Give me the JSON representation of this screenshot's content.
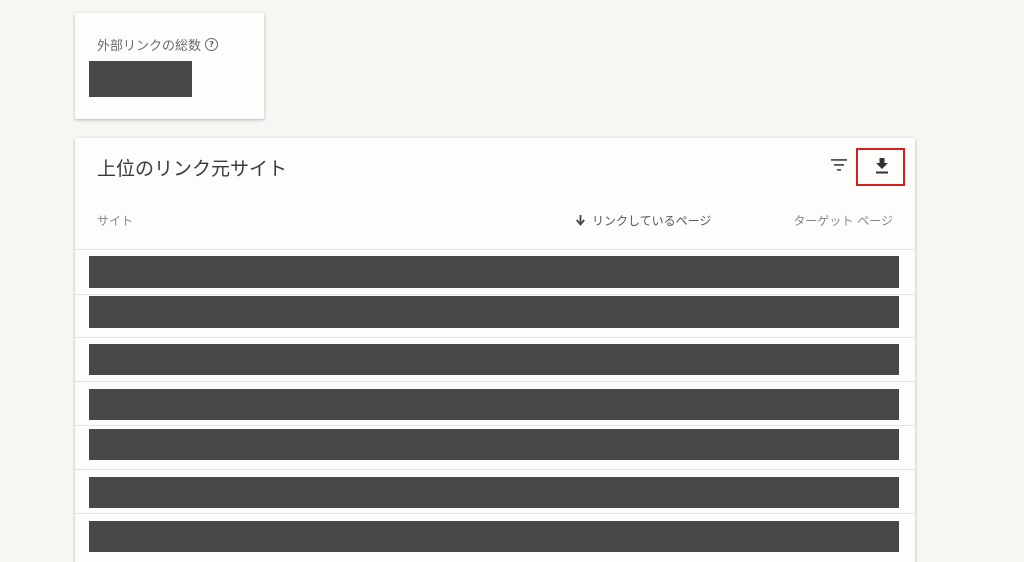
{
  "summary": {
    "total_label": "外部リンクの総数",
    "total_value": ""
  },
  "top_sites": {
    "title": "上位のリンク元サイト",
    "columns": {
      "site": "サイト",
      "linking_pages": "リンクしているページ",
      "target_pages": "ターゲット ページ"
    },
    "sort_column": "linking_pages",
    "sort_direction": "descending",
    "rows_visible": 7
  },
  "icons": {
    "help": "help-circle-icon",
    "filter": "filter-icon",
    "download": "download-icon",
    "sort": "arrow-down-icon"
  },
  "colors": {
    "highlight": "#d62020",
    "redaction": "#444444"
  }
}
